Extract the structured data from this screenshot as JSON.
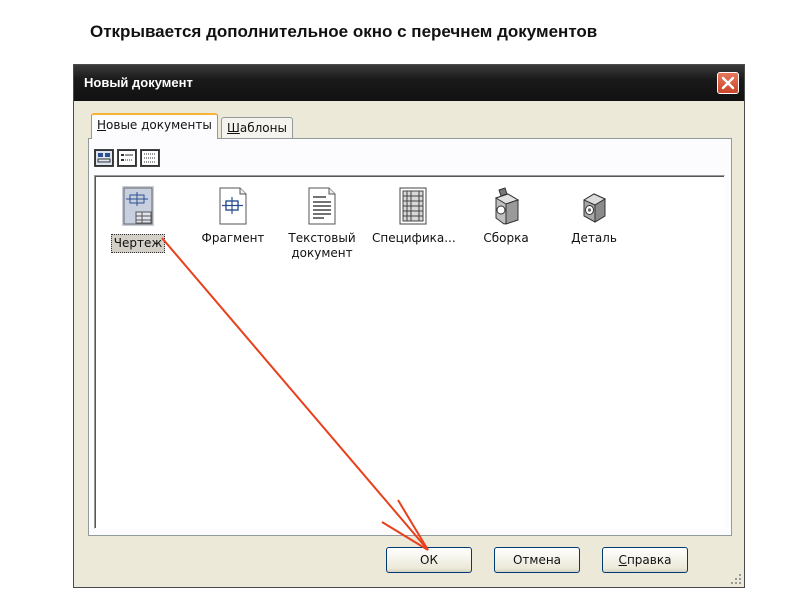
{
  "caption": "Открывается дополнительное окно с перечнем документов",
  "dialog": {
    "title": "Новый документ",
    "tabs": [
      {
        "label_u": "Н",
        "label_rest": "овые документы"
      },
      {
        "label_u": "Ш",
        "label_rest": "аблоны"
      }
    ],
    "items": [
      {
        "label": "Чертеж",
        "icon": "drawing-icon"
      },
      {
        "label": "Фрагмент",
        "icon": "fragment-icon"
      },
      {
        "label": "Текстовый документ",
        "icon": "text-document-icon"
      },
      {
        "label": "Специфика...",
        "icon": "specification-icon"
      },
      {
        "label": "Сборка",
        "icon": "assembly-icon"
      },
      {
        "label": "Деталь",
        "icon": "part-icon"
      }
    ],
    "buttons": {
      "ok": "ОК",
      "cancel": "Отмена",
      "help_u": "С",
      "help_rest": "правка"
    }
  },
  "colors": {
    "arrow": "#e8401c",
    "titlebar": "#1a1a1a",
    "close": "#d9553a",
    "tab_accent": "#f7b23a"
  }
}
